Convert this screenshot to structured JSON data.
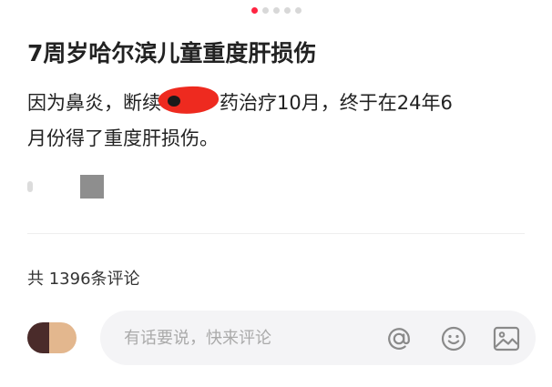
{
  "colors": {
    "accent": "#ff2442",
    "redaction": "#ee2a1f",
    "text_primary": "#222222",
    "text_placeholder": "#aaaaaa",
    "comment_box_bg": "#f4f4f6"
  },
  "pager": {
    "total_pages": 5,
    "current_page": 1
  },
  "post": {
    "title": "7周岁哈尔滨儿童重度肝损伤",
    "body_line1_before": "因为鼻炎，断续",
    "body_line1_after": "药治疗10月，终于在24年6",
    "body_line2": "月份得了重度肝损伤。"
  },
  "comments": {
    "count_label": "共 1396条评论"
  },
  "composer": {
    "placeholder": "有话要说，快来评论",
    "icons": [
      "at-icon",
      "emoji-icon",
      "image-icon"
    ]
  }
}
